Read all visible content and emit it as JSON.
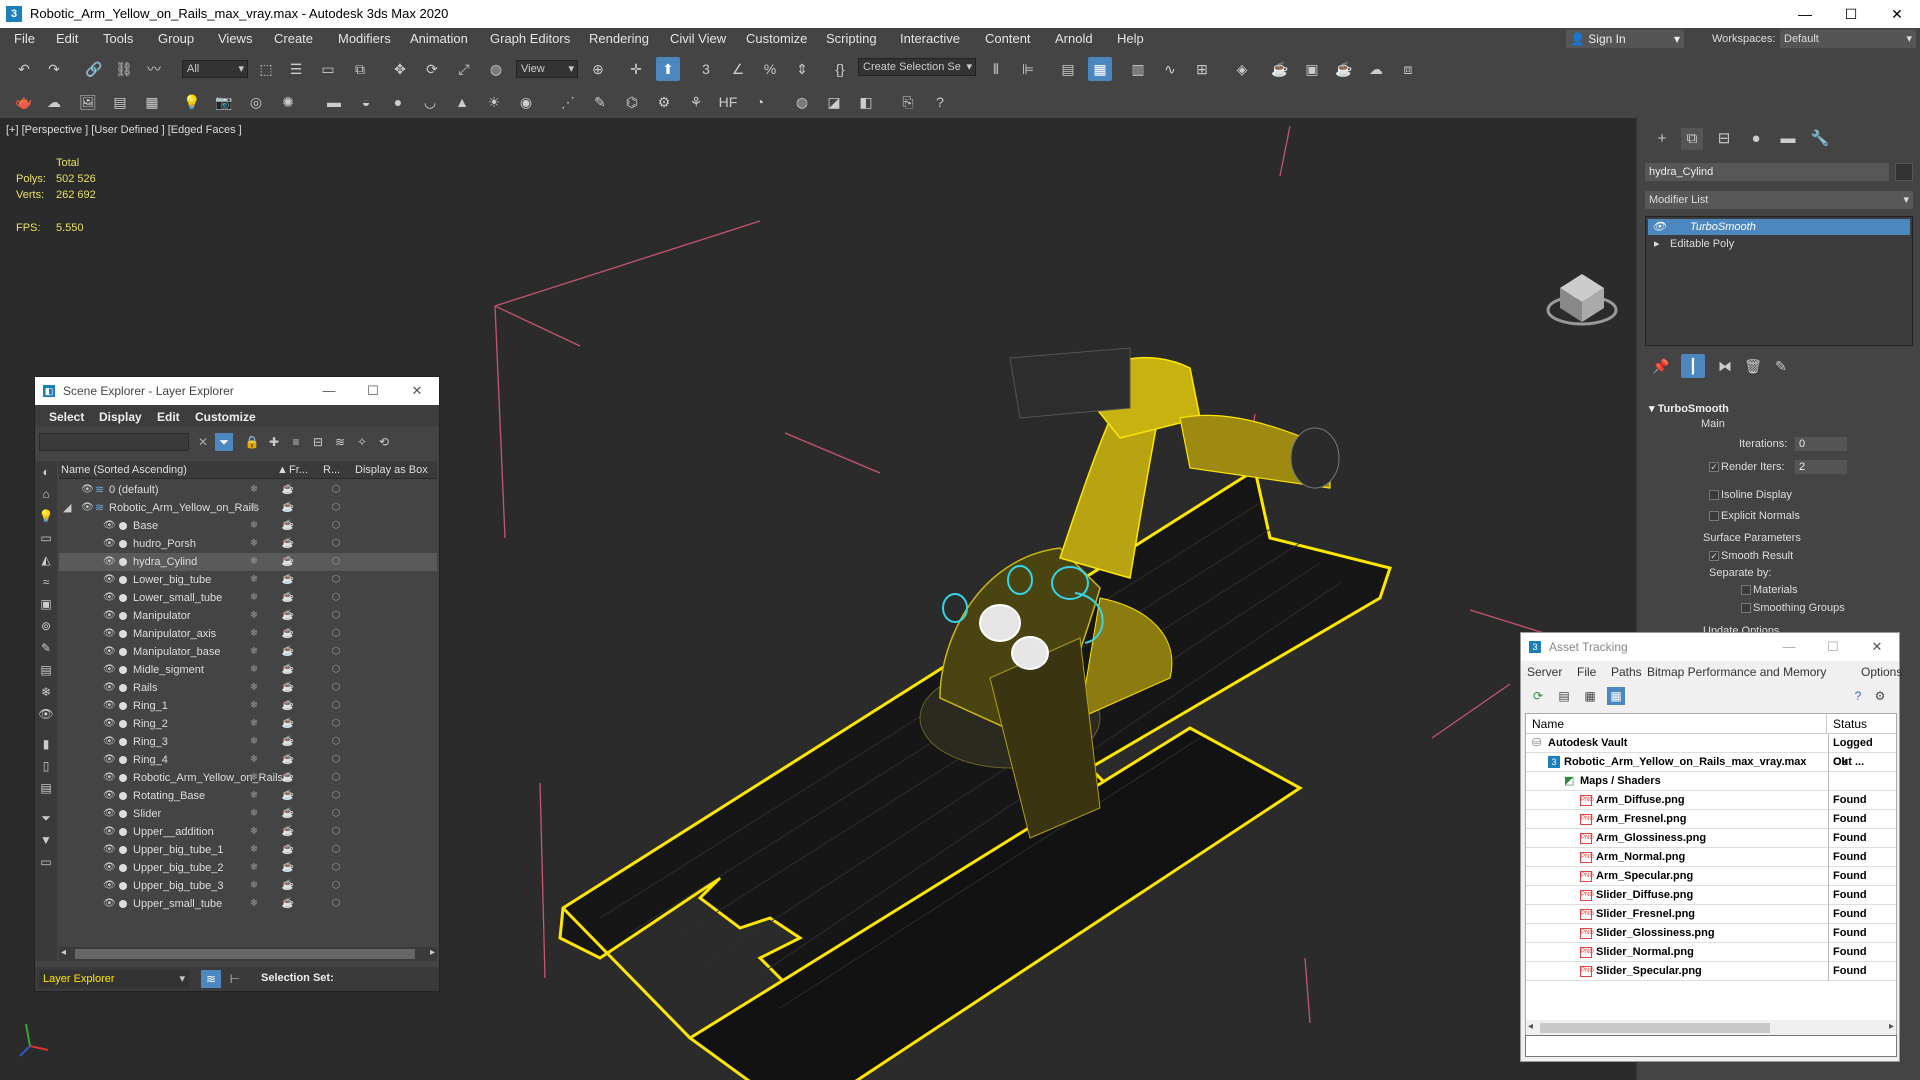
{
  "window": {
    "title": "Robotic_Arm_Yellow_on_Rails_max_vray.max - Autodesk 3ds Max 2020",
    "min": "—",
    "max": "☐",
    "close": "✕"
  },
  "menu": [
    "File",
    "Edit",
    "Tools",
    "Group",
    "Views",
    "Create",
    "Modifiers",
    "Animation",
    "Graph Editors",
    "Rendering",
    "Civil View",
    "Customize",
    "Scripting",
    "Interactive",
    "Content",
    "Arnold",
    "Help"
  ],
  "signin": "Sign In",
  "workspaces": {
    "label": "Workspaces:",
    "value": "Default"
  },
  "toolbar": {
    "selection_filter": "All",
    "ref_coord": "View",
    "create_selection": "Create Selection Se"
  },
  "viewport": {
    "label": "[+] [Perspective ] [User Defined ] [Edged Faces ]",
    "stats_header": "Total",
    "polys_label": "Polys:",
    "polys": "502 526",
    "verts_label": "Verts:",
    "verts": "262 692",
    "fps_label": "FPS:",
    "fps": "5.550"
  },
  "command_panel": {
    "object_name": "hydra_Cylind",
    "modifier_list": "Modifier List",
    "stack": [
      "TurboSmooth",
      "Editable Poly"
    ],
    "rollout": {
      "title": "TurboSmooth",
      "main": "Main",
      "iterations_label": "Iterations:",
      "iterations": "0",
      "render_iters_label": "Render Iters:",
      "render_iters": "2",
      "isoline": "Isoline Display",
      "explicit": "Explicit Normals",
      "surface": "Surface Parameters",
      "smooth": "Smooth Result",
      "separate": "Separate by:",
      "materials": "Materials",
      "smoothing_groups": "Smoothing Groups",
      "update": "Update Options"
    }
  },
  "scene_explorer": {
    "title": "Scene Explorer - Layer Explorer",
    "menu": [
      "Select",
      "Display",
      "Edit",
      "Customize"
    ],
    "columns": {
      "name": "Name (Sorted Ascending)",
      "fr": "Fr...",
      "r": "R...",
      "box": "Display as Box"
    },
    "layers": [
      "0 (default)",
      "Robotic_Arm_Yellow_on_Rails"
    ],
    "objects": [
      "Base",
      "hudro_Porsh",
      "hydra_Cylind",
      "Lower_big_tube",
      "Lower_small_tube",
      "Manipulator",
      "Manipulator_axis",
      "Manipulator_base",
      "Midle_sigment",
      "Rails",
      "Ring_1",
      "Ring_2",
      "Ring_3",
      "Ring_4",
      "Robotic_Arm_Yellow_on_Rails",
      "Rotating_Base",
      "Slider",
      "Upper__addition",
      "Upper_big_tube_1",
      "Upper_big_tube_2",
      "Upper_big_tube_3",
      "Upper_small_tube"
    ],
    "selected": "hydra_Cylind",
    "footer_explorer": "Layer Explorer",
    "footer_selset": "Selection Set:"
  },
  "asset_tracking": {
    "title": "Asset Tracking",
    "menu": [
      "Server",
      "File",
      "Paths",
      "Bitmap Performance and Memory",
      "Options"
    ],
    "col_name": "Name",
    "col_status": "Status",
    "vault": {
      "name": "Autodesk Vault",
      "status": "Logged Out ..."
    },
    "file": {
      "name": "Robotic_Arm_Yellow_on_Rails_max_vray.max",
      "status": "Ok"
    },
    "maps": "Maps / Shaders",
    "textures": [
      {
        "name": "Arm_Diffuse.png",
        "status": "Found"
      },
      {
        "name": "Arm_Fresnel.png",
        "status": "Found"
      },
      {
        "name": "Arm_Glossiness.png",
        "status": "Found"
      },
      {
        "name": "Arm_Normal.png",
        "status": "Found"
      },
      {
        "name": "Arm_Specular.png",
        "status": "Found"
      },
      {
        "name": "Slider_Diffuse.png",
        "status": "Found"
      },
      {
        "name": "Slider_Fresnel.png",
        "status": "Found"
      },
      {
        "name": "Slider_Glossiness.png",
        "status": "Found"
      },
      {
        "name": "Slider_Normal.png",
        "status": "Found"
      },
      {
        "name": "Slider_Specular.png",
        "status": "Found"
      }
    ]
  },
  "colors": {
    "accent": "#4d87bf",
    "selection": "#ffe600",
    "highlight": "#35d6e8"
  }
}
